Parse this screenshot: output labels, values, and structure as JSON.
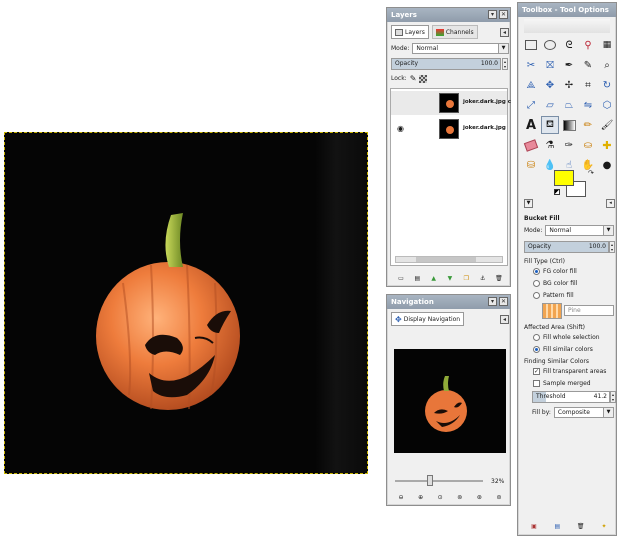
{
  "layers_panel": {
    "title": "Layers",
    "tabs": [
      {
        "label": "Layers"
      },
      {
        "label": "Channels"
      }
    ],
    "mode_label": "Mode:",
    "mode_value": "Normal",
    "opacity_label": "Opacity",
    "opacity_value": "100.0",
    "lock_label": "Lock:",
    "layers": [
      {
        "name": "joker.dark.jpg c",
        "visible": false
      },
      {
        "name": "joker.dark.jpg",
        "visible": true
      }
    ]
  },
  "navigation_panel": {
    "title": "Navigation",
    "tab_label": "Display Navigation",
    "zoom_percent": "32%"
  },
  "toolbox": {
    "title": "Toolbox - Tool Options",
    "fg_color": "#ffff00",
    "bg_color": "#ffffff",
    "tool_options": {
      "tool_name": "Bucket Fill",
      "mode_label": "Mode:",
      "mode_value": "Normal",
      "opacity_label": "Opacity",
      "opacity_value": "100.0",
      "fill_type_label": "Fill Type  (Ctrl)",
      "fill_types": [
        {
          "label": "FG color fill",
          "selected": true
        },
        {
          "label": "BG color fill",
          "selected": false
        },
        {
          "label": "Pattern fill",
          "selected": false
        }
      ],
      "pattern_name": "Pine",
      "affected_area_label": "Affected Area  (Shift)",
      "affected_areas": [
        {
          "label": "Fill whole selection",
          "selected": false
        },
        {
          "label": "Fill similar colors",
          "selected": true
        }
      ],
      "finding_label": "Finding Similar Colors",
      "fill_transparent_label": "Fill transparent areas",
      "fill_transparent_checked": true,
      "sample_merged_label": "Sample merged",
      "sample_merged_checked": false,
      "threshold_label": "Threshold",
      "threshold_value": "41.2",
      "fill_by_label": "Fill by:",
      "fill_by_value": "Composite"
    }
  },
  "colors": {
    "pumpkin": "#e8763a",
    "stem": "#8faa38",
    "titlebar": "#9aa7b5",
    "canvas_border": "#c8b400"
  }
}
